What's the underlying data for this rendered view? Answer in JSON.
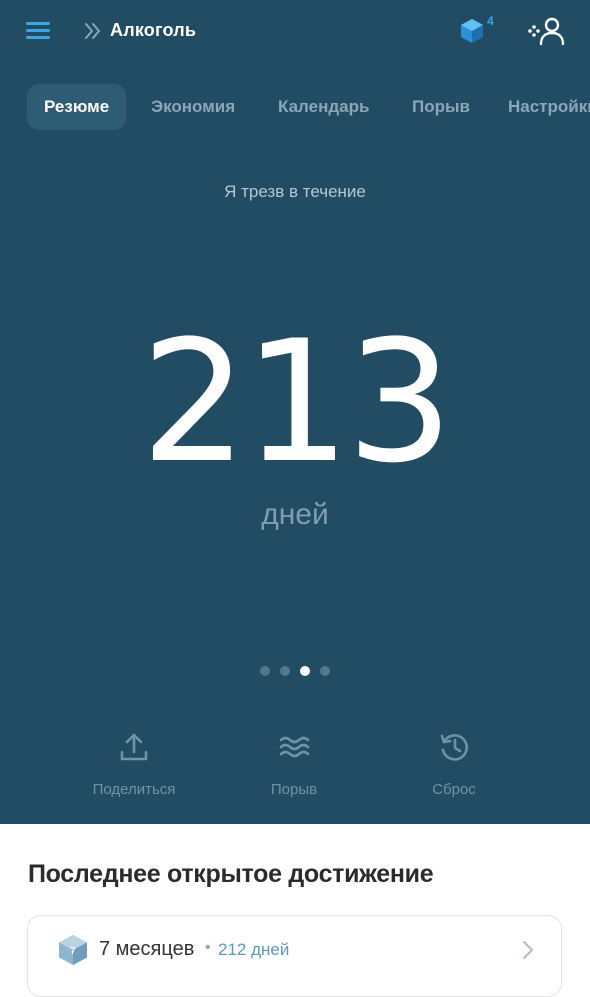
{
  "header": {
    "title": "Алкоголь",
    "gem_count": "4",
    "icons": {
      "menu": "hamburger-icon",
      "breadcrumb": "double-chevron-icon",
      "gem": "gem-icon",
      "profile": "profile-add-icon"
    }
  },
  "tabs": [
    {
      "label": "Резюме",
      "active": true
    },
    {
      "label": "Экономия",
      "active": false
    },
    {
      "label": "Календарь",
      "active": false
    },
    {
      "label": "Порыв",
      "active": false
    },
    {
      "label": "Настройки",
      "active": false
    }
  ],
  "summary": {
    "caption": "Я трезв в течение",
    "count": "213",
    "unit": "дней",
    "pager": {
      "total": 4,
      "active_index": 2
    }
  },
  "actions": [
    {
      "label": "Поделиться",
      "icon": "share-icon"
    },
    {
      "label": "Порыв",
      "icon": "waves-icon"
    },
    {
      "label": "Сброс",
      "icon": "history-reset-icon"
    }
  ],
  "achievement": {
    "section_title": "Последнее открытое достижение",
    "badge_number": "7",
    "name": "7 месяцев",
    "separator": "•",
    "days": "212 дней"
  },
  "colors": {
    "hero_bg": "#224c63",
    "accent": "#3aa6e6",
    "tab_active_bg": "#2f5c75"
  }
}
